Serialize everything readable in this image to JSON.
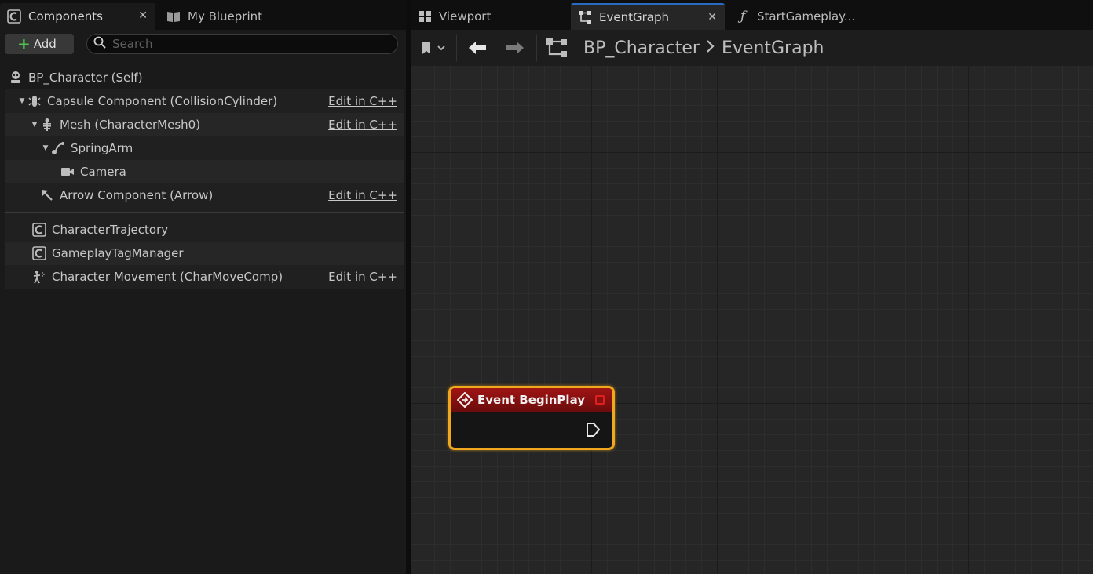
{
  "left_tabs": [
    {
      "label": "Components",
      "icon": "component-icon",
      "closable": true,
      "active": true
    },
    {
      "label": "My Blueprint",
      "icon": "book-icon",
      "closable": false,
      "active": false
    }
  ],
  "toolbar": {
    "add_label": "Add",
    "search_placeholder": "Search"
  },
  "tree": {
    "root": {
      "label": "BP_Character (Self)",
      "icon": "character-icon"
    },
    "items": [
      {
        "label": "Capsule Component (CollisionCylinder)",
        "icon": "capsule-icon",
        "edit": "Edit in C++"
      },
      {
        "label": "Mesh (CharacterMesh0)",
        "icon": "skeleton-icon",
        "edit": "Edit in C++"
      },
      {
        "label": "SpringArm",
        "icon": "spring-arm-icon",
        "edit": ""
      },
      {
        "label": "Camera",
        "icon": "camera-icon",
        "edit": ""
      },
      {
        "label": "Arrow Component (Arrow)",
        "icon": "arrow-component-icon",
        "edit": "Edit in C++"
      },
      {
        "label": "CharacterTrajectory",
        "icon": "component-icon",
        "edit": ""
      },
      {
        "label": "GameplayTagManager",
        "icon": "component-icon",
        "edit": ""
      },
      {
        "label": "Character Movement (CharMoveComp)",
        "icon": "movement-icon",
        "edit": "Edit in C++"
      }
    ]
  },
  "right_tabs": [
    {
      "label": "Viewport",
      "icon": "viewport-icon",
      "closable": false,
      "active": false
    },
    {
      "label": "EventGraph",
      "icon": "graph-icon",
      "closable": true,
      "active": true
    },
    {
      "label": "StartGameplay...",
      "icon": "function-icon",
      "closable": false,
      "active": false
    }
  ],
  "breadcrumb": {
    "blueprint": "BP_Character",
    "graph": "EventGraph"
  },
  "node": {
    "title": "Event BeginPlay"
  },
  "colors": {
    "accent_tab": "#2a6cc4",
    "node_border": "#f0a81e",
    "node_header": "#a01414",
    "add_plus": "#4fc24f"
  }
}
